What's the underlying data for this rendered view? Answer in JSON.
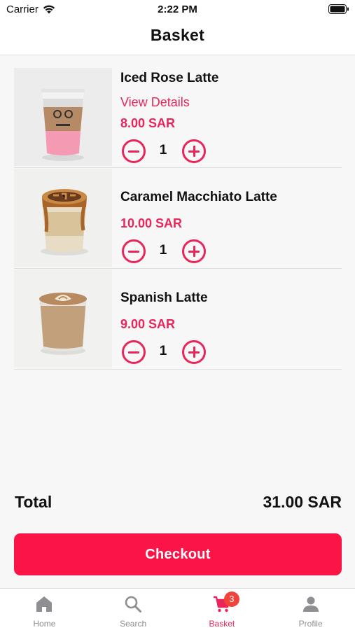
{
  "status_bar": {
    "carrier": "Carrier",
    "time": "2:22 PM"
  },
  "header": {
    "title": "Basket"
  },
  "items": [
    {
      "name": "Iced Rose Latte",
      "details_link": "View Details",
      "price": "8.00 SAR",
      "quantity": "1"
    },
    {
      "name": "Caramel Macchiato Latte",
      "price": "10.00 SAR",
      "quantity": "1"
    },
    {
      "name": "Spanish Latte",
      "price": "9.00 SAR",
      "quantity": "1"
    }
  ],
  "total": {
    "label": "Total",
    "amount": "31.00 SAR"
  },
  "checkout": {
    "label": "Checkout"
  },
  "tab_bar": {
    "tabs": [
      {
        "label": "Home",
        "icon": "home-icon"
      },
      {
        "label": "Search",
        "icon": "search-icon"
      },
      {
        "label": "Basket",
        "icon": "cart-icon",
        "badge": "3",
        "active": true
      },
      {
        "label": "Profile",
        "icon": "person-icon"
      }
    ]
  },
  "colors": {
    "accent": "#e8265a",
    "checkout": "#fb1446",
    "badge": "#f2433a",
    "inactive": "#8e8e93"
  }
}
